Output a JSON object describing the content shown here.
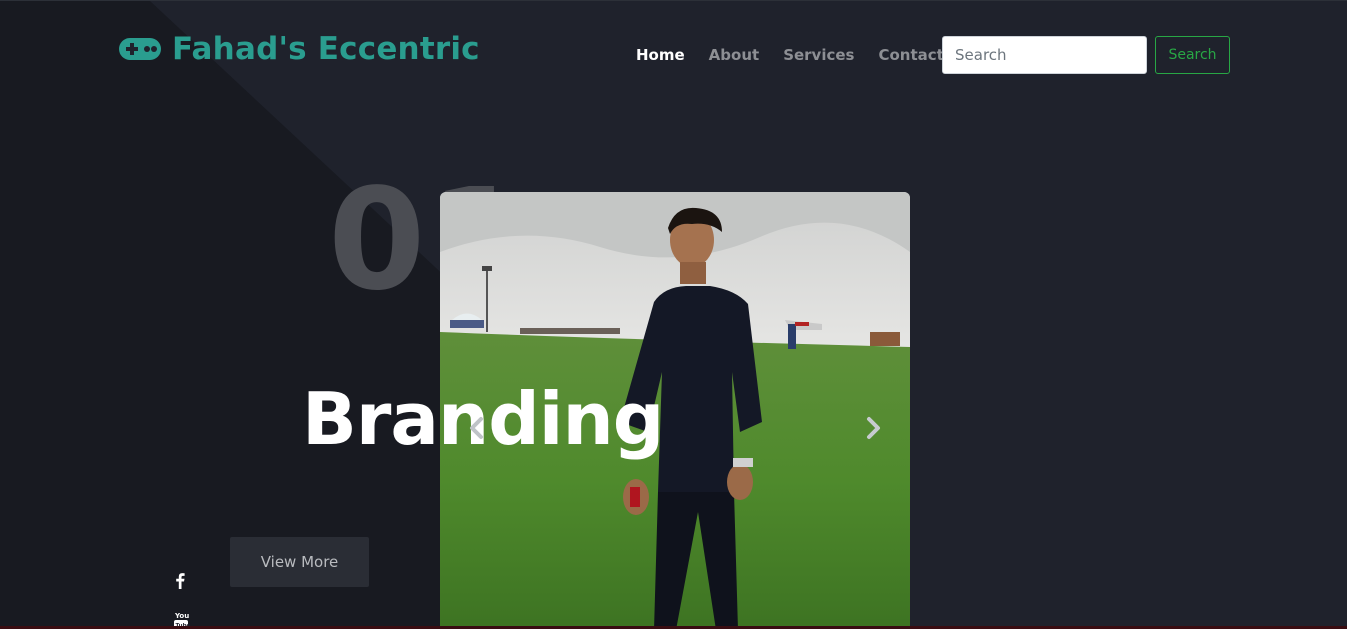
{
  "brand": {
    "name": "Fahad's Eccentric",
    "icon": "gamepad-icon",
    "color": "#2a9d8f"
  },
  "nav": {
    "items": [
      {
        "label": "Home",
        "active": true
      },
      {
        "label": "About",
        "active": false
      },
      {
        "label": "Services",
        "active": false
      },
      {
        "label": "Contact",
        "active": false
      }
    ]
  },
  "search": {
    "placeholder": "Search",
    "value": "",
    "button_label": "Search",
    "button_color": "#28a745"
  },
  "hero": {
    "slide_number": "01",
    "title": "Branding",
    "cta_label": "View More",
    "prev_icon": "chevron-left-icon",
    "next_icon": "chevron-right-icon"
  },
  "social": {
    "icons": [
      "facebook-icon",
      "youtube-icon"
    ]
  },
  "colors": {
    "background": "#1f222c",
    "accent": "#2a9d8f"
  }
}
